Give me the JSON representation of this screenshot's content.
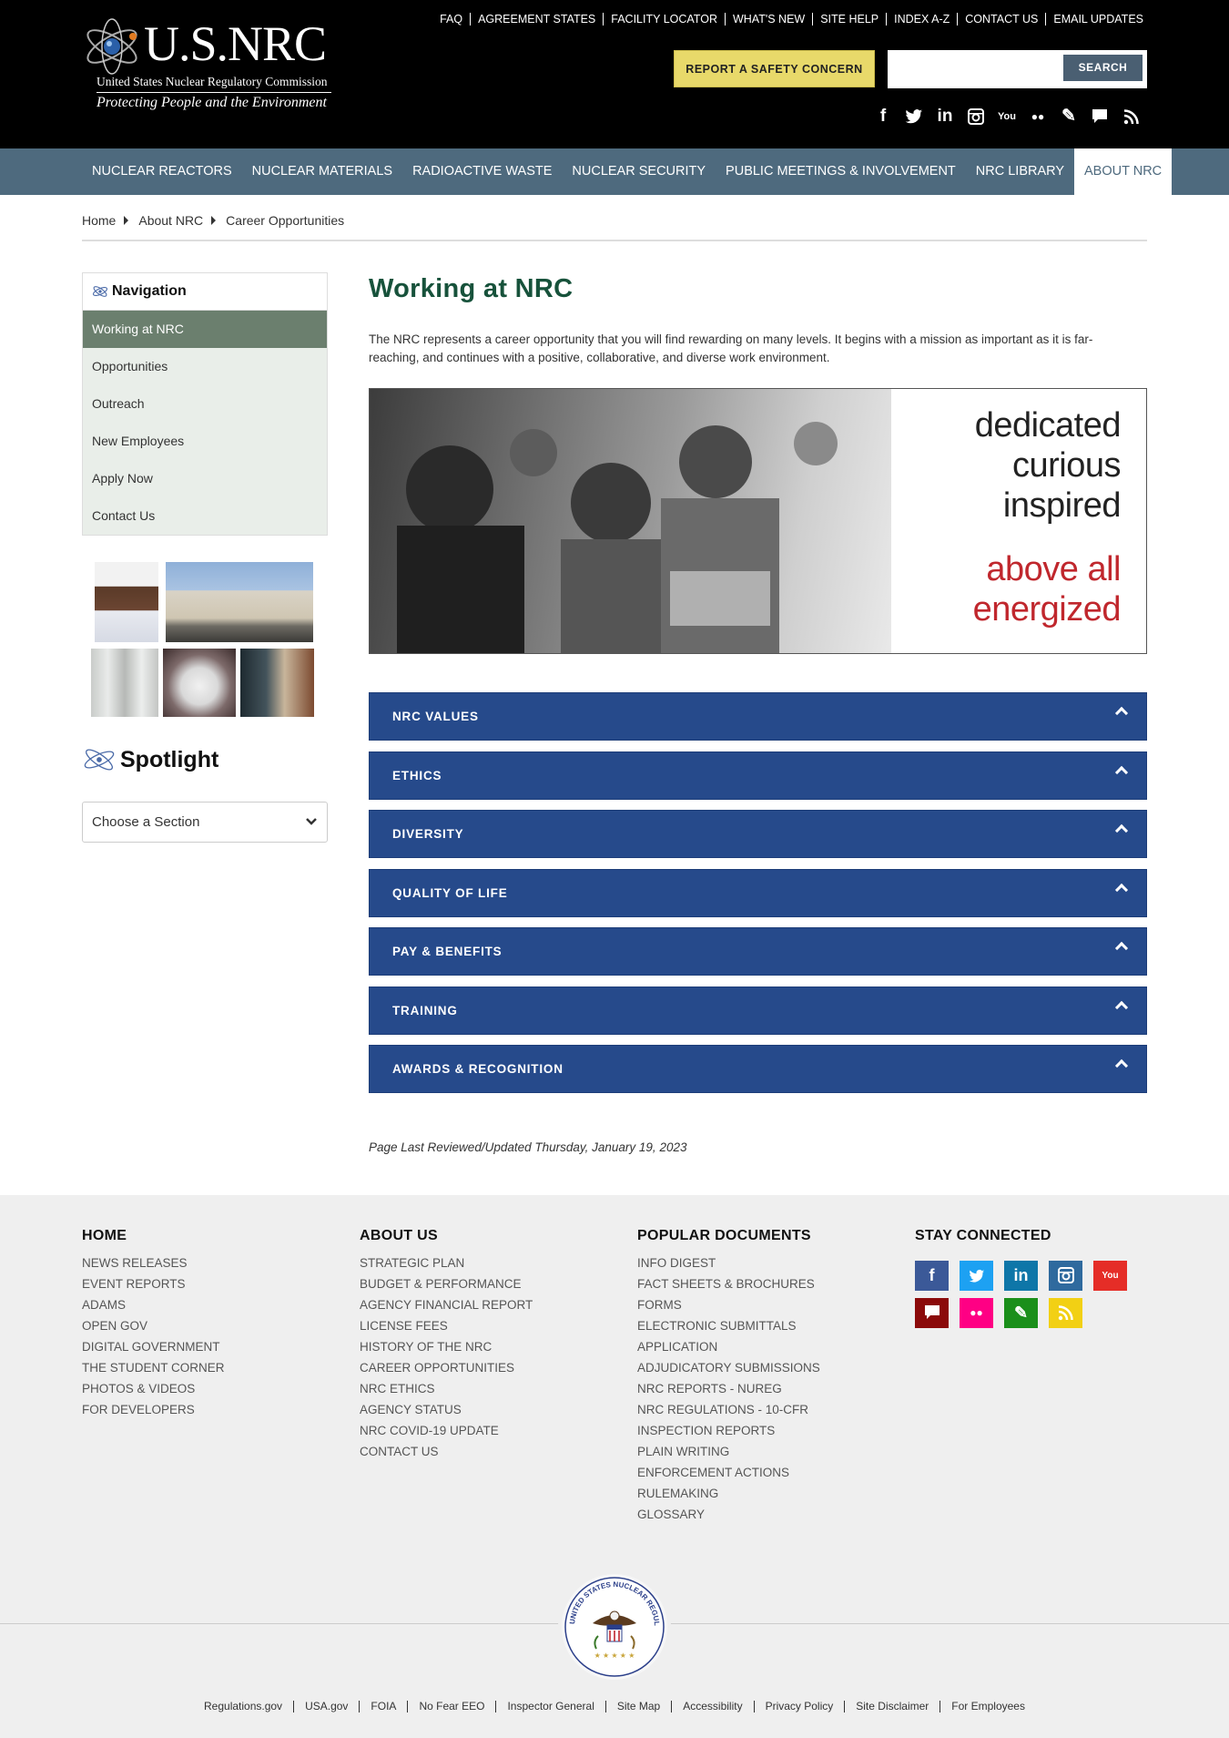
{
  "header": {
    "logo_title": "U.S.NRC",
    "logo_subtitle": "United States Nuclear Regulatory Commission",
    "logo_tagline": "Protecting People and the Environment",
    "util_links": [
      "FAQ",
      "AGREEMENT STATES",
      "FACILITY LOCATOR",
      "WHAT'S NEW",
      "SITE HELP",
      "INDEX A-Z",
      "CONTACT US",
      "EMAIL UPDATES"
    ],
    "report_label": "REPORT A SAFETY CONCERN",
    "search_placeholder": "",
    "search_label": "SEARCH",
    "social_icons": [
      "facebook-icon",
      "twitter-icon",
      "linkedin-icon",
      "instagram-icon",
      "youtube-icon",
      "flickr-icon",
      "blog-icon",
      "comment-icon",
      "rss-icon"
    ]
  },
  "mainnav": {
    "items": [
      "NUCLEAR REACTORS",
      "NUCLEAR MATERIALS",
      "RADIOACTIVE WASTE",
      "NUCLEAR SECURITY",
      "PUBLIC MEETINGS & INVOLVEMENT",
      "NRC LIBRARY",
      "ABOUT NRC"
    ],
    "active": "ABOUT NRC"
  },
  "breadcrumb": [
    "Home",
    "About NRC",
    "Career Opportunities"
  ],
  "sidebar": {
    "nav_title": "Navigation",
    "items": [
      "Working at NRC",
      "Opportunities",
      "Outreach",
      "New Employees",
      "Apply Now",
      "Contact Us"
    ],
    "active": "Working at NRC",
    "spotlight_title": "Spotlight",
    "choose_label": "Choose a Section"
  },
  "main": {
    "title": "Working at NRC",
    "intro": "The NRC represents a career opportunity that you will find rewarding on many levels. It begins with a mission as important as it is far-reaching, and continues with a positive, collaborative, and diverse work environment.",
    "hero_words": [
      "dedicated",
      "curious",
      "inspired"
    ],
    "hero_words_red": [
      "above all",
      "energized"
    ],
    "accordions": [
      "NRC VALUES",
      "ETHICS",
      "DIVERSITY",
      "QUALITY OF LIFE",
      "PAY & BENEFITS",
      "TRAINING",
      "AWARDS & RECOGNITION"
    ],
    "reviewed": "Page Last Reviewed/Updated Thursday, January 19, 2023"
  },
  "footer": {
    "columns": [
      {
        "title": "HOME",
        "links": [
          "NEWS RELEASES",
          "EVENT REPORTS",
          "ADAMS",
          "OPEN GOV",
          "DIGITAL GOVERNMENT",
          "THE STUDENT CORNER",
          "PHOTOS & VIDEOS",
          "FOR DEVELOPERS"
        ]
      },
      {
        "title": "ABOUT US",
        "links": [
          "STRATEGIC PLAN",
          "BUDGET & PERFORMANCE",
          "AGENCY FINANCIAL REPORT",
          "LICENSE FEES",
          "HISTORY OF THE NRC",
          "CAREER OPPORTUNITIES",
          "NRC ETHICS",
          "AGENCY STATUS",
          "NRC COVID-19 UPDATE",
          "CONTACT US"
        ]
      },
      {
        "title": "POPULAR DOCUMENTS",
        "links": [
          "INFO DIGEST",
          "FACT SHEETS & BROCHURES",
          "FORMS",
          "ELECTRONIC SUBMITTALS",
          "APPLICATION",
          "ADJUDICATORY SUBMISSIONS",
          "NRC REPORTS - NUREG",
          "NRC REGULATIONS - 10-CFR",
          "INSPECTION REPORTS",
          "PLAIN WRITING",
          "ENFORCEMENT ACTIONS",
          "RULEMAKING",
          "GLOSSARY"
        ]
      },
      {
        "title": "STAY CONNECTED",
        "links": []
      }
    ],
    "social": [
      {
        "name": "facebook-icon",
        "glyph": "f",
        "color": "#3b5998"
      },
      {
        "name": "twitter-icon",
        "glyph": "t",
        "color": "#1da1f2"
      },
      {
        "name": "linkedin-icon",
        "glyph": "in",
        "color": "#0e76a8"
      },
      {
        "name": "instagram-icon",
        "glyph": "◘",
        "color": "#2f6a9e"
      },
      {
        "name": "youtube-icon",
        "glyph": "▶",
        "color": "#e52d27"
      },
      {
        "name": "comment-icon",
        "glyph": "▬",
        "color": "#8b0a0a"
      },
      {
        "name": "flickr-icon",
        "glyph": "●●",
        "color": "#ff0084"
      },
      {
        "name": "blog-icon",
        "glyph": "✎",
        "color": "#1a8f1a"
      },
      {
        "name": "rss-icon",
        "glyph": "◔",
        "color": "#f2d014"
      }
    ],
    "seal_text": "UNITED STATES NUCLEAR REGULATORY COMMISSION",
    "legal_links": [
      "Regulations.gov",
      "USA.gov",
      "FOIA",
      "No Fear EEO",
      "Inspector General",
      "Site Map",
      "Accessibility",
      "Privacy Policy",
      "Site Disclaimer",
      "For Employees"
    ]
  }
}
